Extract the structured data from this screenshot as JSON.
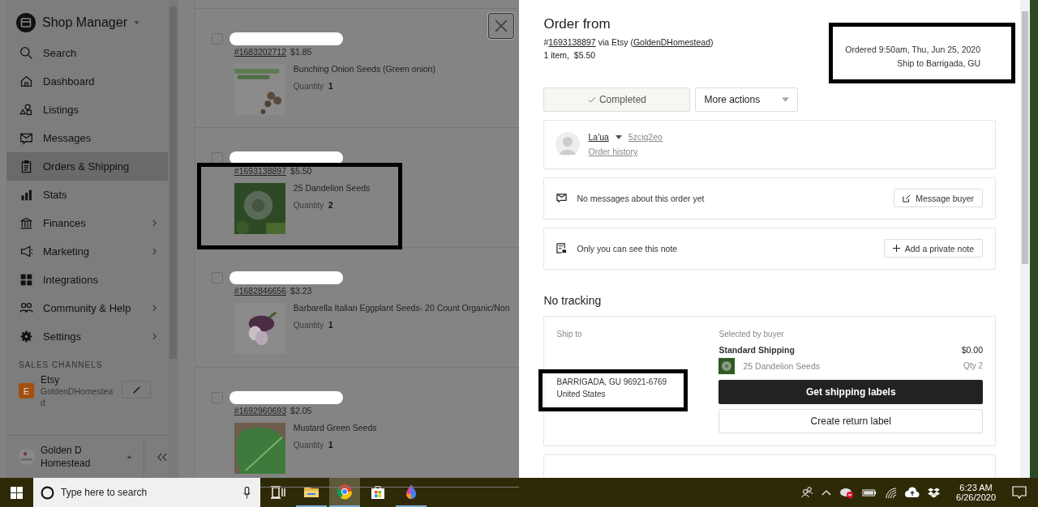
{
  "sidebar": {
    "title": "Shop Manager",
    "items": [
      {
        "label": "Search",
        "selected": false,
        "submenu": false
      },
      {
        "label": "Dashboard",
        "selected": false,
        "submenu": false
      },
      {
        "label": "Listings",
        "selected": false,
        "submenu": false
      },
      {
        "label": "Messages",
        "selected": false,
        "submenu": false
      },
      {
        "label": "Orders & Shipping",
        "selected": true,
        "submenu": false
      },
      {
        "label": "Stats",
        "selected": false,
        "submenu": false
      },
      {
        "label": "Finances",
        "selected": false,
        "submenu": true
      },
      {
        "label": "Marketing",
        "selected": false,
        "submenu": true
      },
      {
        "label": "Integrations",
        "selected": false,
        "submenu": false
      },
      {
        "label": "Community & Help",
        "selected": false,
        "submenu": true
      },
      {
        "label": "Settings",
        "selected": false,
        "submenu": true
      }
    ],
    "section_heading": "SALES CHANNELS",
    "channel": {
      "badge": "E",
      "name": "Etsy",
      "shop": "GoldenDHomestead"
    },
    "footer": {
      "shop": "Golden D Homestead"
    }
  },
  "orders": [
    {
      "number": "#1683202712",
      "price": "$1.85",
      "product": "Bunching Onion Seeds (Green onion)",
      "quantity_label": "Quantity",
      "quantity": "1",
      "checked": false,
      "highlighted": false
    },
    {
      "number": "#1693138897",
      "price": "$5.50",
      "product": "25 Dandelion Seeds",
      "quantity_label": "Quantity",
      "quantity": "2",
      "checked": false,
      "highlighted": true
    },
    {
      "number": "#1682846656",
      "price": "$3.23",
      "product": "Barbarella Italian Eggplant Seeds- 20 Count Organic/Non",
      "quantity_label": "Quantity",
      "quantity": "1",
      "checked": false,
      "highlighted": false
    },
    {
      "number": "#1692960693",
      "price": "$2.05",
      "product": "Mustard Green Seeds",
      "quantity_label": "Quantity",
      "quantity": "1",
      "checked": false,
      "highlighted": false
    }
  ],
  "detail": {
    "title": "Order from",
    "ref_hash": "#",
    "ref_number": "1693138897",
    "ref_via": "via Etsy (",
    "ref_shop": "GoldenDHomestead",
    "ref_close": ")",
    "summary": "1 item,  $5.50",
    "ordered": "Ordered 9:50am, Thu, Jun 25, 2020",
    "ship_to": "Ship to Barrigada, GU",
    "header_highlighted": true,
    "status": "Completed",
    "more_actions": "More actions",
    "buyer": {
      "name": "La'ua",
      "username": "5zciq2eo",
      "history": "Order history"
    },
    "messages": {
      "text": "No messages about this order yet",
      "button": "Message buyer"
    },
    "note": {
      "text": "Only you can see this note",
      "button": "Add a private note"
    },
    "tracking_heading": "No tracking",
    "shipping": {
      "ship_to_label": "Ship to",
      "address": [
        "BARRIGADA, GU 96921-6769",
        "United States"
      ],
      "address_highlighted": true,
      "selected_by": "Selected by buyer",
      "method": "Standard Shipping",
      "cost": "$0.00",
      "item": "25 Dandelion Seeds",
      "qty": "Qty 2",
      "primary_button": "Get shipping labels",
      "secondary_button": "Create return label"
    }
  },
  "taskbar": {
    "search_placeholder": "Type here to search",
    "apps": [
      {
        "running": false,
        "selected": false
      },
      {
        "running": true,
        "selected": false
      },
      {
        "running": true,
        "selected": true
      },
      {
        "running": false,
        "selected": false
      },
      {
        "running": true,
        "selected": false
      }
    ],
    "time": "6:23 AM",
    "date": "6/26/2020"
  }
}
